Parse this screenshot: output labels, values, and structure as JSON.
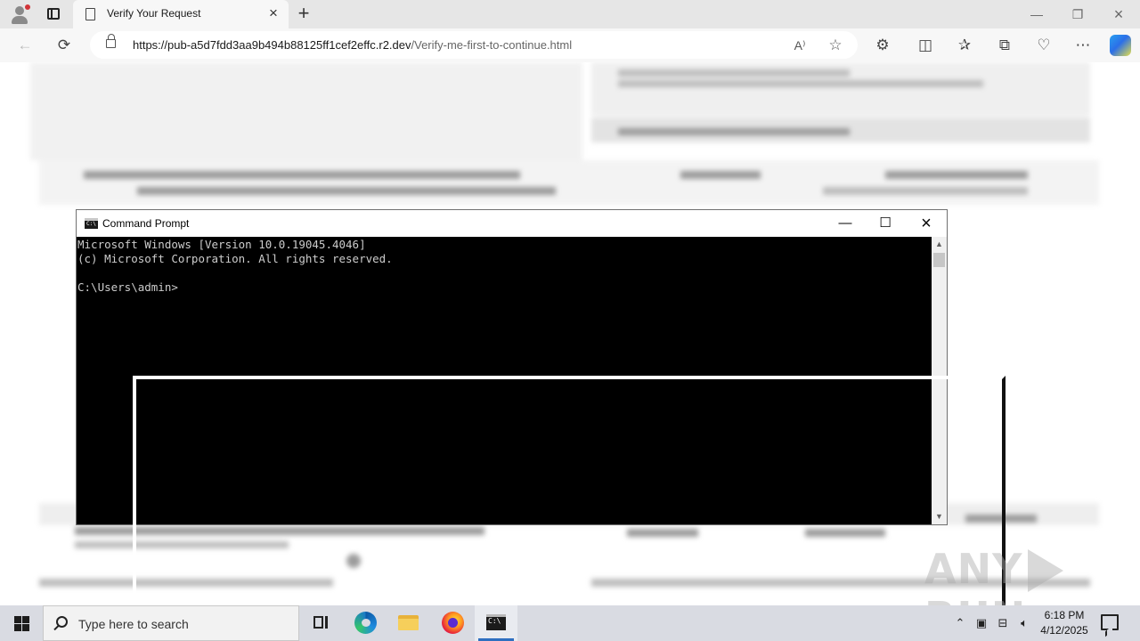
{
  "browser": {
    "tab_title": "Verify Your Request",
    "url_host": "https://pub-a5d7fdd3aa9b494b88125ff1cef2effc.r2.dev",
    "url_path": "/Verify-me-first-to-continue.html"
  },
  "cmd_window": {
    "title": "Command Prompt",
    "lines": [
      "Microsoft Windows [Version 10.0.19045.4046]",
      "(c) Microsoft Corporation. All rights reserved.",
      "",
      "C:\\Users\\admin>"
    ]
  },
  "taskbar": {
    "search_placeholder": "Type here to search",
    "time": "6:18 PM",
    "date": "4/12/2025",
    "apps": [
      "task-view-icon",
      "edge-icon",
      "file-explorer-icon",
      "firefox-icon",
      "command-prompt-icon"
    ]
  },
  "watermark": {
    "left": "ANY",
    "right": "RUN"
  },
  "colors": {
    "console_bg": "#000000",
    "console_text": "#cccccc",
    "taskbar_bg": "#d9dbe2",
    "tab_strip_bg": "#e6e6e6"
  }
}
